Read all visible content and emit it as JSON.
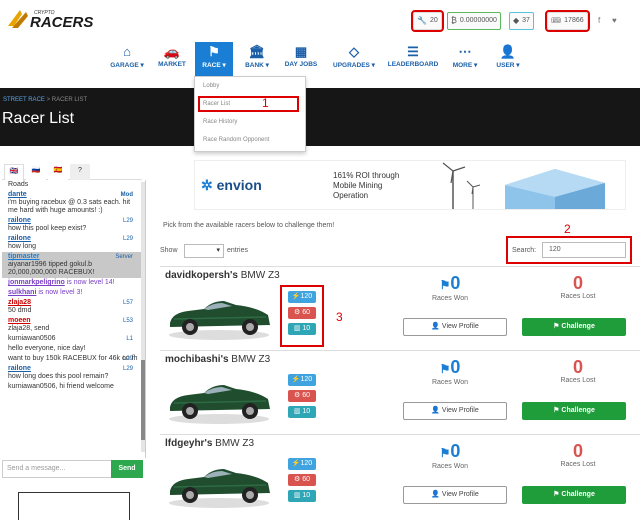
{
  "header": {
    "stats": [
      {
        "icon": "wrench-icon",
        "glyph": "🔧",
        "value": "20"
      },
      {
        "icon": "bitcoin-icon",
        "glyph": "₿",
        "value": "0.00000000"
      },
      {
        "icon": "diamond-icon",
        "glyph": "◆",
        "value": "37"
      },
      {
        "icon": "ticket-icon",
        "glyph": "🎟",
        "value": "17866"
      }
    ],
    "social": [
      "f",
      "♥"
    ]
  },
  "nav": {
    "items": [
      {
        "id": "garage",
        "label": "GARAGE ▾",
        "glyph": "⌂"
      },
      {
        "id": "market",
        "label": "MARKET",
        "glyph": "🚗"
      },
      {
        "id": "race",
        "label": "RACE ▾",
        "glyph": "⚑"
      },
      {
        "id": "bank",
        "label": "BANK ▾",
        "glyph": "🏛"
      },
      {
        "id": "day-jobs",
        "label": "DAY JOBS",
        "glyph": "▦"
      },
      {
        "id": "upgrades",
        "label": "UPGRADES ▾",
        "glyph": "◇"
      },
      {
        "id": "leaderboard",
        "label": "LEADERBOARD",
        "glyph": "☰"
      },
      {
        "id": "more",
        "label": "MORE ▾",
        "glyph": "⋯"
      },
      {
        "id": "user",
        "label": "USER ▾",
        "glyph": "👤"
      }
    ]
  },
  "dropdown": {
    "items": [
      "Lobby",
      "Racer List",
      "Race History",
      "Race Random Opponent"
    ]
  },
  "annotations": [
    "1",
    "2",
    "3"
  ],
  "breadcrumb": {
    "first": "STREET RACE",
    "sep": ">",
    "current": "RACER LIST"
  },
  "page_title": "Racer List",
  "chat": {
    "tabs": [
      "🇬🇧",
      "🇷🇺",
      "🇪🇸",
      "?"
    ],
    "messages": [
      {
        "user": "",
        "text": "Roads",
        "level": "",
        "type": "plain"
      },
      {
        "user": "dante",
        "text": "i'm buying racebux @ 0.3 sats each. hit me hard with huge amounts! :)",
        "level": "Mod",
        "type": "mod"
      },
      {
        "user": "railone",
        "text": "how this pool keep exist?",
        "level": "L29",
        "type": "plain"
      },
      {
        "user": "railone",
        "text": "how long",
        "level": "L29",
        "type": "plain"
      },
      {
        "user": "tipmaster",
        "text": "aiyanar1996 tipped gokul.b 20,000,000,000 RACEBUX!",
        "level": "Server",
        "type": "server"
      },
      {
        "user": "jonmarkpeligrino",
        "text": " is now level 14!",
        "level": "",
        "type": "levelup"
      },
      {
        "user": "sulkhani",
        "text": " is now level 3!",
        "level": "",
        "type": "levelup"
      },
      {
        "user": "zlaja28",
        "text": "50 dmd",
        "level": "L57",
        "type": "red"
      },
      {
        "user": "moeen",
        "text": "zlaja28, send",
        "level": "L53",
        "type": "red"
      },
      {
        "user": "",
        "text": "kurniawan0506",
        "level": "L1",
        "type": "plain"
      },
      {
        "user": "",
        "text": "hello everyone, nice day!",
        "level": "",
        "type": "plain"
      },
      {
        "user": "",
        "text": "want to buy 150k RACEBUX for 46k on fh",
        "level": "L29",
        "type": "plain"
      },
      {
        "user": "railone",
        "text": "how long does this pool remain?",
        "level": "L29",
        "type": "plain"
      },
      {
        "user": "",
        "text": "kurniawan0506, hi friend welcome",
        "level": "",
        "type": "plain"
      }
    ],
    "input_placeholder": "Send a message...",
    "send_label": "Send"
  },
  "banner": {
    "logo": "envion",
    "text_line1": "161% ROI through",
    "text_line2": "Mobile Mining",
    "text_line3": "Operation"
  },
  "table": {
    "intro": "Pick from the available racers below to challenge them!",
    "show_label": "Show",
    "entries_label": "entries",
    "search_label": "Search:",
    "search_value": "120",
    "view_label": "View Profile",
    "challenge_label": "Challenge",
    "won_label": "Races Won",
    "lost_label": "Races Lost",
    "rows": [
      {
        "name": "davidkopersh's",
        "car": "BMW Z3",
        "speed": "120",
        "power": "60",
        "handling": "10",
        "won": "0",
        "lost": "0"
      },
      {
        "name": "mochibashi's",
        "car": "BMW Z3",
        "speed": "120",
        "power": "60",
        "handling": "10",
        "won": "0",
        "lost": "0"
      },
      {
        "name": "lfdgeyhr's",
        "car": "BMW Z3",
        "speed": "120",
        "power": "60",
        "handling": "10",
        "won": "0",
        "lost": "0"
      }
    ]
  },
  "colors": {
    "accent": "#1a7fd4",
    "challenge": "#1f9d3a",
    "annotation": "#dd0000"
  }
}
